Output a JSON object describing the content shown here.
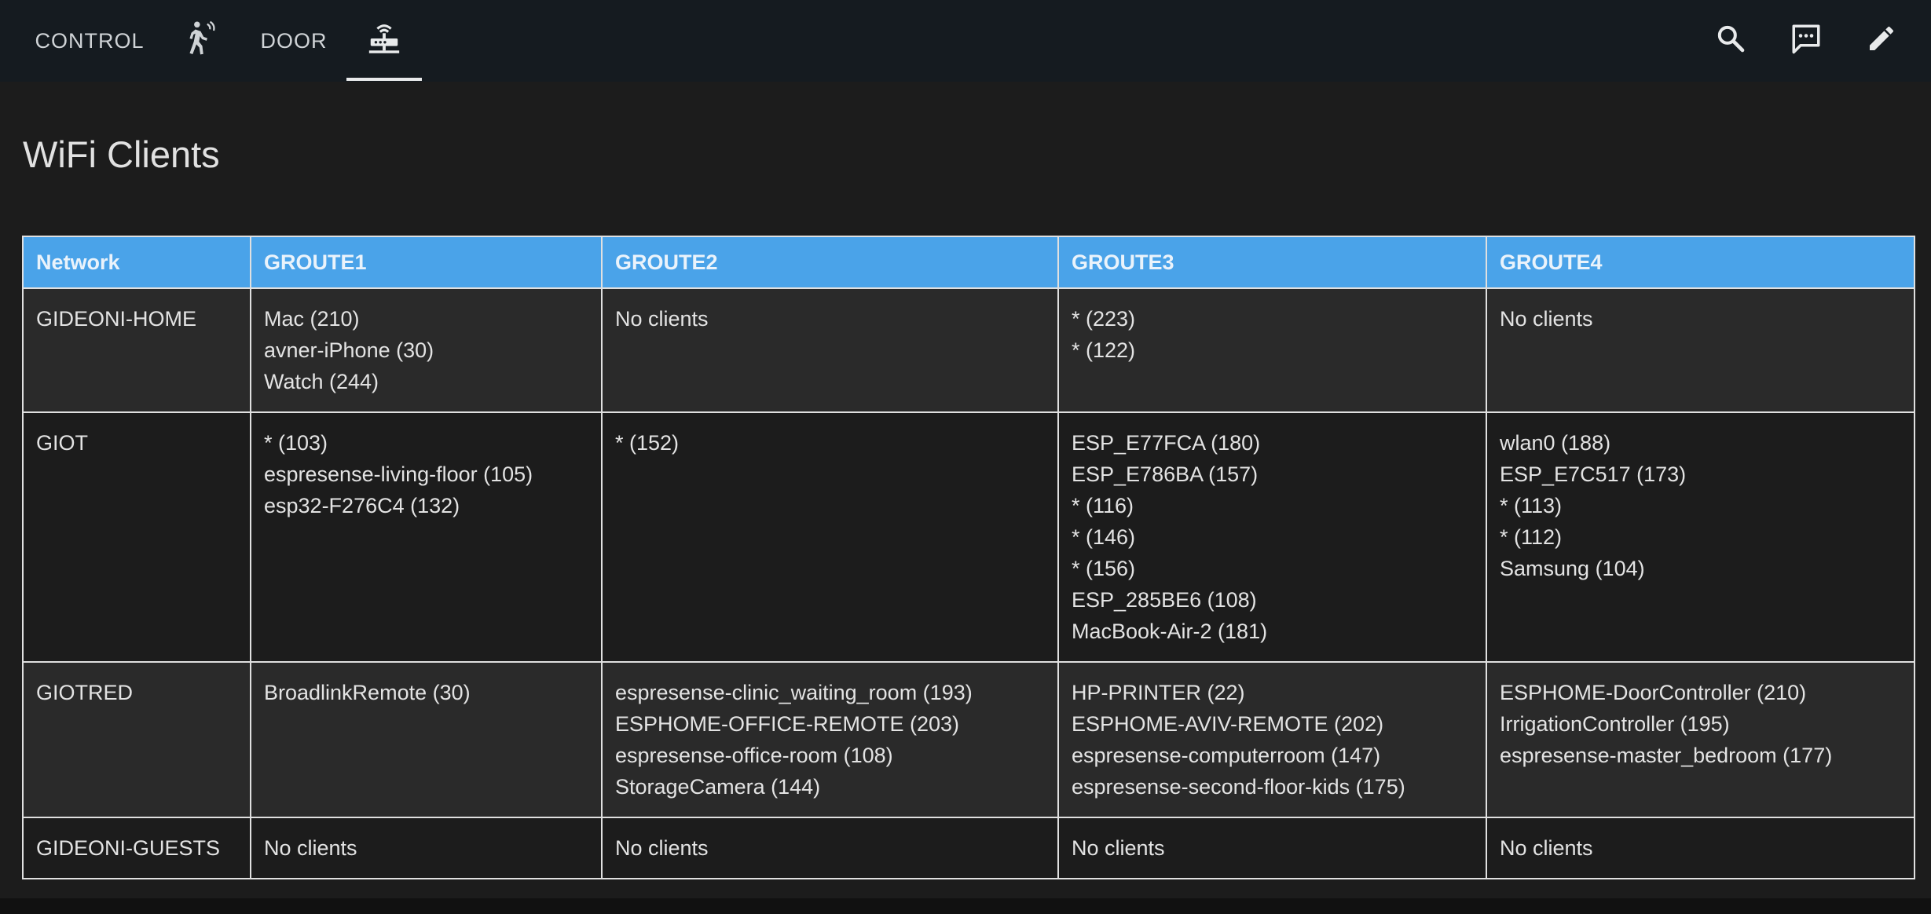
{
  "tabs": [
    {
      "label": "CONTROL",
      "icon": null
    },
    {
      "label": null,
      "icon": "motion-sensor-icon"
    },
    {
      "label": "DOOR",
      "icon": null
    },
    {
      "label": null,
      "icon": "router-icon",
      "active": true
    }
  ],
  "actions": [
    {
      "icon": "search-icon"
    },
    {
      "icon": "chat-icon"
    },
    {
      "icon": "edit-pencil-icon"
    }
  ],
  "page": {
    "title": "WiFi Clients"
  },
  "table": {
    "columns": [
      "Network",
      "GROUTE1",
      "GROUTE2",
      "GROUTE3",
      "GROUTE4"
    ],
    "rows": [
      {
        "network": "GIDEONI-HOME",
        "cells": [
          [
            "Mac (210)",
            "avner-iPhone (30)",
            "Watch (244)"
          ],
          [
            "No clients"
          ],
          [
            "* (223)",
            "* (122)"
          ],
          [
            "No clients"
          ]
        ]
      },
      {
        "network": "GIOT",
        "cells": [
          [
            "* (103)",
            "espresense-living-floor (105)",
            "esp32-F276C4 (132)"
          ],
          [
            "* (152)"
          ],
          [
            "ESP_E77FCA (180)",
            "ESP_E786BA (157)",
            "* (116)",
            "* (146)",
            "* (156)",
            "ESP_285BE6 (108)",
            "MacBook-Air-2 (181)"
          ],
          [
            "wlan0 (188)",
            "ESP_E7C517 (173)",
            "* (113)",
            "* (112)",
            "Samsung (104)"
          ]
        ]
      },
      {
        "network": "GIOTRED",
        "cells": [
          [
            "BroadlinkRemote (30)"
          ],
          [
            "espresense-clinic_waiting_room (193)",
            "ESPHOME-OFFICE-REMOTE (203)",
            "espresense-office-room (108)",
            "StorageCamera (144)"
          ],
          [
            "HP-PRINTER (22)",
            "ESPHOME-AVIV-REMOTE (202)",
            "espresense-computerroom (147)",
            "espresense-second-floor-kids (175)"
          ],
          [
            "ESPHOME-DoorController (210)",
            "IrrigationController (195)",
            "espresense-master_bedroom (177)"
          ]
        ]
      },
      {
        "network": "GIDEONI-GUESTS",
        "cells": [
          [
            "No clients"
          ],
          [
            "No clients"
          ],
          [
            "No clients"
          ],
          [
            "No clients"
          ]
        ]
      }
    ]
  },
  "colors": {
    "header_bar": "#151b20",
    "table_header": "#4aa3e9",
    "background": "#1c1c1c"
  }
}
